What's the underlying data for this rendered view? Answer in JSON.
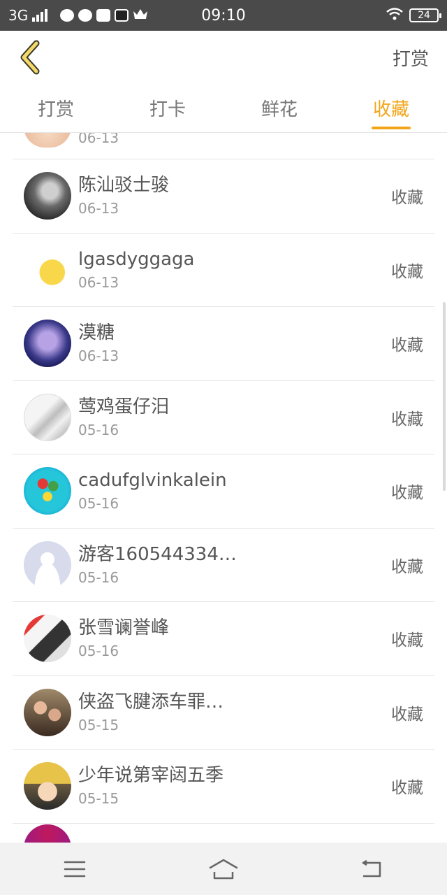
{
  "status_bar": {
    "network": "3G",
    "time": "09:10",
    "battery": "24"
  },
  "header": {
    "action_label": "打赏"
  },
  "tabs": [
    {
      "label": "打赏"
    },
    {
      "label": "打卡"
    },
    {
      "label": "鲜花"
    },
    {
      "label": "收藏",
      "active": true
    }
  ],
  "list": {
    "partial_top_date": "06-13",
    "items": [
      {
        "name": "陈汕驳士骏",
        "date": "06-13",
        "type": "收藏"
      },
      {
        "name": "lgasdyggaga",
        "date": "06-13",
        "type": "收藏"
      },
      {
        "name": "漠糖",
        "date": "06-13",
        "type": "收藏"
      },
      {
        "name": "莺鸡蛋仔汨",
        "date": "05-16",
        "type": "收藏"
      },
      {
        "name": "cadufglvinkalein",
        "date": "05-16",
        "type": "收藏"
      },
      {
        "name": "游客160544334…",
        "date": "05-16",
        "type": "收藏"
      },
      {
        "name": "张雪谰誉峰",
        "date": "05-16",
        "type": "收藏"
      },
      {
        "name": "侠盗飞腱添车罪…",
        "date": "05-15",
        "type": "收藏"
      },
      {
        "name": "少年说第宰闼五季",
        "date": "05-15",
        "type": "收藏"
      }
    ]
  },
  "colors": {
    "accent": "#f2a51a",
    "status_bar": "#4a4a4a",
    "nav_bar": "#f2f2f2"
  },
  "icons": {
    "back": "chevron-left-icon",
    "menu": "menu-icon",
    "home": "home-icon",
    "return": "back-arrow-icon"
  }
}
